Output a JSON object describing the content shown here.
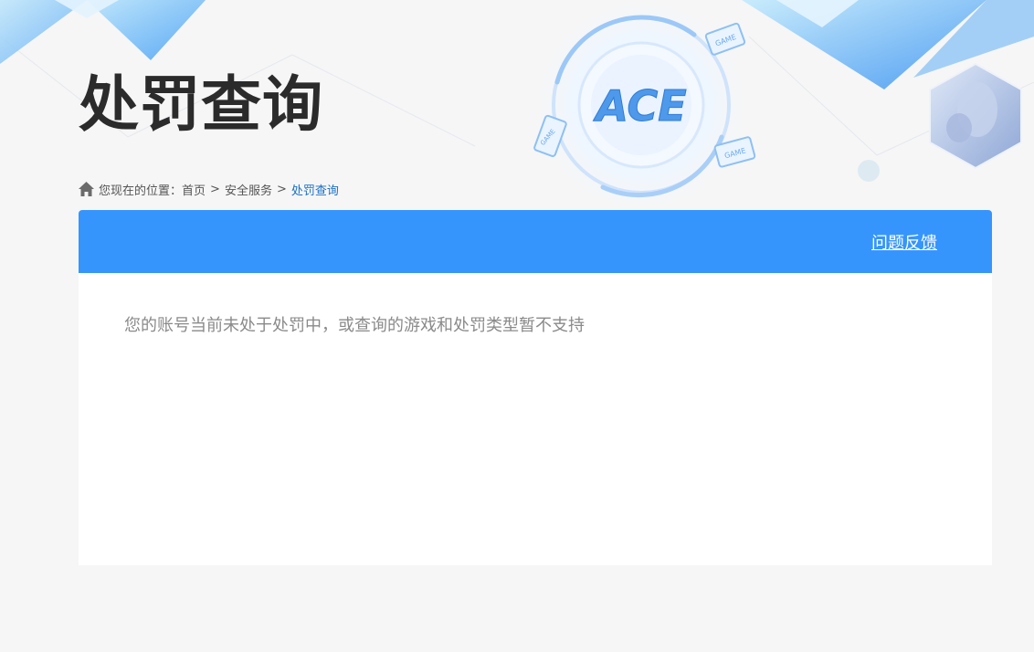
{
  "header": {
    "title": "处罚查询",
    "logo_text": "ACE",
    "badge_text": "GAME"
  },
  "breadcrumb": {
    "label": "您现在的位置：",
    "items": [
      "首页",
      "安全服务"
    ],
    "separator": ">",
    "current": "处罚查询"
  },
  "panel": {
    "feedback_label": "问题反馈",
    "message": "您的账号当前未处于处罚中，或查询的游戏和处罚类型暂不支持"
  },
  "colors": {
    "accent": "#3695fc",
    "breadcrumb_current": "#1a6fc4",
    "background": "#f6f6f6"
  }
}
